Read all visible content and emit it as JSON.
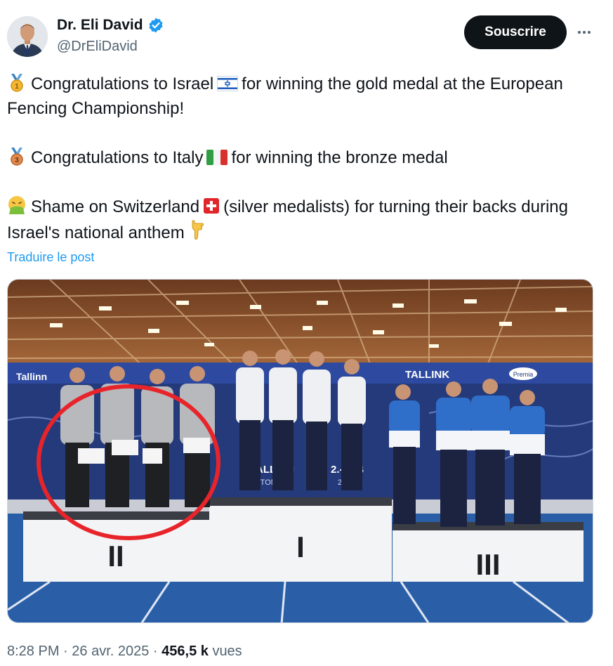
{
  "author": {
    "name": "Dr. Eli David",
    "handle": "@DrEliDavid"
  },
  "actions": {
    "subscribe_label": "Souscrire"
  },
  "tweet": {
    "p1_prefix": "Congratulations to Israel",
    "p1_suffix": "for winning the gold medal at the European Fencing Championship!",
    "p2_prefix": "Congratulations to Italy",
    "p2_suffix": "for winning the bronze medal",
    "p3_prefix": "Shame on Switzerland",
    "p3_suffix": "(silver medalists) for turning their backs during Israel's national anthem",
    "translate_label": "Traduire le post"
  },
  "media": {
    "banner_left": "Tallinn",
    "banner_tallink": "TALLINK",
    "banner_prem": "Premia",
    "banner_city": "TALLINN",
    "banner_estonia": "ESTONIA",
    "banner_date": "2.-7.04",
    "banner_year": "2025",
    "podium_second": "II",
    "podium_first": "I",
    "podium_third": "III"
  },
  "meta": {
    "time": "8:28 PM",
    "date": "26 avr. 2025",
    "views_count": "456,5 k",
    "views_label": "vues"
  },
  "colors": {
    "accent": "#1d9bf0",
    "circle": "#e8242b",
    "dark_button": "#0f1419"
  }
}
